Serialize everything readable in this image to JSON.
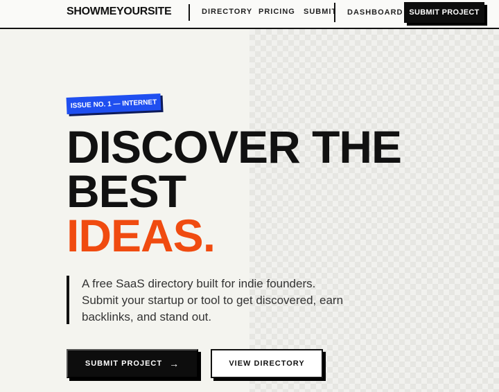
{
  "site": {
    "logo": "SHOWMEYOURSITE"
  },
  "nav": {
    "items": [
      "DIRECTORY",
      "PRICING",
      "SUBMIT",
      "DASHBOARD"
    ],
    "cta": "SUBMIT PROJECT"
  },
  "hero": {
    "badge": "ISSUE NO. 1 — INTERNET",
    "title_line1": "DISCOVER THE",
    "title_line2": "BEST",
    "title_accent": "IDEAS.",
    "lead_line1": "A free SaaS directory built for indie founders.",
    "lead_line2": "Submit your startup or tool to get discovered, earn",
    "lead_line3": "backlinks, and stand out.",
    "primary_cta": "SUBMIT PROJECT",
    "secondary_cta": "VIEW DIRECTORY"
  },
  "icons": {
    "primary_cta_arrow": "arrow-right-icon"
  },
  "colors": {
    "accent": "#f04b10",
    "badge": "#1f4ff0",
    "ink": "#0d0d0d"
  }
}
